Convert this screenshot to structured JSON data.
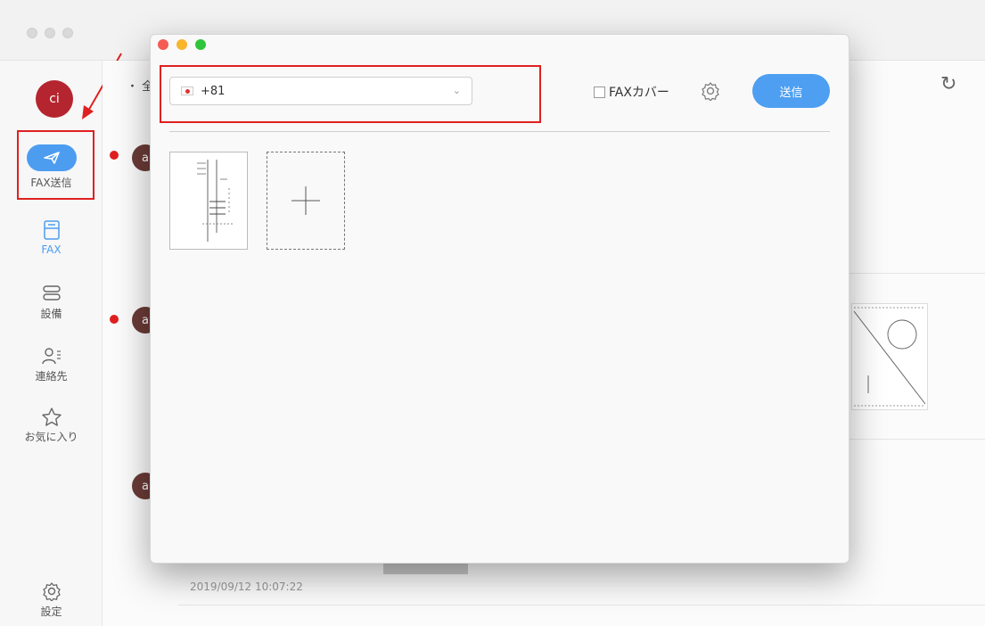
{
  "window": {
    "title": ""
  },
  "sidebar": {
    "avatar_initials": "ci",
    "items": [
      {
        "label": "FAX送信",
        "icon": "paper-plane-icon"
      },
      {
        "label": "FAX",
        "icon": "fax-inbox-icon"
      },
      {
        "label": "設備",
        "icon": "devices-icon"
      },
      {
        "label": "連絡先",
        "icon": "contacts-icon"
      },
      {
        "label": "お気に入り",
        "icon": "star-icon"
      },
      {
        "label": "設定",
        "icon": "gear-icon"
      }
    ]
  },
  "list": {
    "filter_prefix": "・ 全",
    "rows": [
      {
        "avatar": "a",
        "unread": true
      },
      {
        "avatar": "a",
        "unread": true
      },
      {
        "avatar": "a",
        "unread": false
      }
    ],
    "timestamp": "2019/09/12 10:07:22"
  },
  "modal": {
    "country_code": "+81",
    "flag": "jp-flag",
    "fax_cover_label": "FAXカバー",
    "fax_cover_checked": false,
    "send_label": "送信"
  },
  "colors": {
    "accent": "#4e9ff1",
    "highlight": "#e02020",
    "avatar": "#b5252f"
  }
}
